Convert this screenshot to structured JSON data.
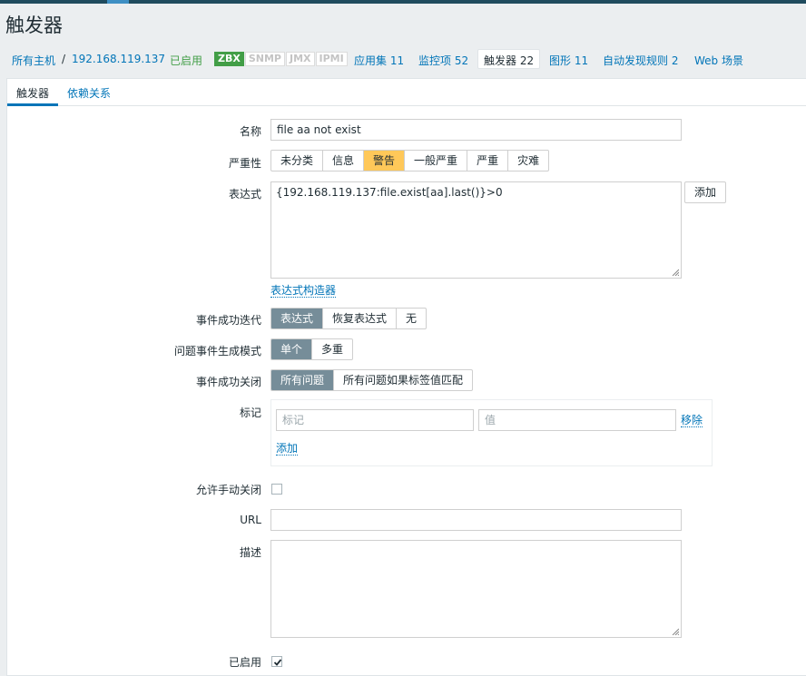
{
  "page": {
    "title": "触发器"
  },
  "nav": {
    "all_hosts": "所有主机",
    "separator": "/",
    "host": "192.168.119.137",
    "status": "已启用",
    "badges": [
      {
        "label": "ZBX",
        "active": true
      },
      {
        "label": "SNMP",
        "active": false
      },
      {
        "label": "JMX",
        "active": false
      },
      {
        "label": "IPMI",
        "active": false
      }
    ],
    "applications": "应用集 11",
    "items": "监控项 52",
    "triggers": "触发器 22",
    "graphs": "图形 11",
    "discovery": "自动发现规则 2",
    "web": "Web 场景"
  },
  "tabs": {
    "trigger": "触发器",
    "dependencies": "依赖关系"
  },
  "form": {
    "name_label": "名称",
    "name_value": "file aa not exist",
    "severity_label": "严重性",
    "severity_options": [
      "未分类",
      "信息",
      "警告",
      "一般严重",
      "严重",
      "灾难"
    ],
    "severity_selected": "警告",
    "expression_label": "表达式",
    "expression_value": "{192.168.119.137:file.exist[aa].last()}>0",
    "add_button": "添加",
    "expression_constructor": "表达式构造器",
    "ok_event_label": "事件成功迭代",
    "ok_event_options": [
      "表达式",
      "恢复表达式",
      "无"
    ],
    "ok_event_selected": "表达式",
    "problem_mode_label": "问题事件生成模式",
    "problem_mode_options": [
      "单个",
      "多重"
    ],
    "problem_mode_selected": "单个",
    "ok_close_label": "事件成功关闭",
    "ok_close_options": [
      "所有问题",
      "所有问题如果标签值匹配"
    ],
    "ok_close_selected": "所有问题",
    "tags_label": "标记",
    "tag_placeholder": "标记",
    "value_placeholder": "值",
    "remove_link": "移除",
    "add_link": "添加",
    "manual_close_label": "允许手动关闭",
    "manual_close_checked": false,
    "url_label": "URL",
    "url_value": "",
    "description_label": "描述",
    "description_value": "",
    "enabled_label": "已启用",
    "enabled_checked": true
  },
  "colors": {
    "link": "#0275b8",
    "selected_gray": "#768d99",
    "severity_warning": "#ffc859",
    "enabled_green": "#429e47"
  }
}
